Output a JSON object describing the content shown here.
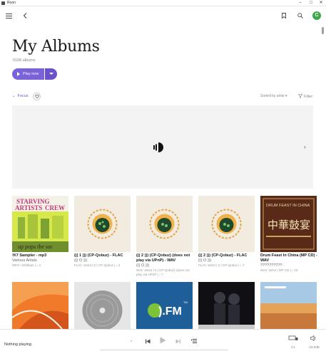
{
  "window": {
    "app_name": "Roon",
    "minimize": "–",
    "maximize": "□",
    "close": "✕"
  },
  "header": {
    "title": "My Albums",
    "count": "5108 albums",
    "avatar_letter": "C"
  },
  "actions": {
    "play_now": "Play now",
    "focus": "Focus",
    "sort": "Sorted by artist",
    "filter": "Filter"
  },
  "albums": [
    {
      "title": "!K7 Sampler - mp3",
      "artist": "Various Artists",
      "format": "MP3 • 320kbps | ♪ 4"
    },
    {
      "title": "((( 1 ))) (CP-Qobuz) - FLAC",
      "artist": "((( O )))",
      "format": "FLAC 16/44 | 2 | CP-Qobuz | ♪ 4"
    },
    {
      "title": "((( 2 ))) (CP-Qobuz) (does not play via UPnP) - WAV",
      "artist": "((( O )))",
      "format": "WAV 16/44 | 2 | CP-Qobuz) (does not play via UPnP | ♪ 7"
    },
    {
      "title": "((( 2 ))) (CP-Qobuz) - FLAC",
      "artist": "((( O )))",
      "format": "FLAC 16/44 | 2 | CP-Qobuz | ♪ 7"
    },
    {
      "title": "Drum Feast In China (MP CD) - WAV",
      "artist": "??????????",
      "format": "WAV 16/44 | MP CD | ♪ 16"
    }
  ],
  "album_art_text": {
    "starving_line1": "STARVING",
    "starving_line2": "ARTISTS",
    "starving_line3": "CREW",
    "starving_bottom": "up pops the sac",
    "drum_title": "DRUM FEAST IN CHINA",
    "drum_chars": "中華鼓宴",
    "fm_text": ").FM",
    "tm": "TM"
  },
  "playbar": {
    "status": "Nothing playing",
    "zone_label": "C1",
    "volume_label": "-19.0dB"
  },
  "colors": {
    "accent": "#7a63d9",
    "avatar": "#3fa94a"
  },
  "icons": [
    "hamburger-icon",
    "back-icon",
    "bookmark-icon",
    "search-icon",
    "heart-icon",
    "filter-icon",
    "roon-logo-icon",
    "prev-icon",
    "play-icon",
    "next-icon",
    "queue-icon",
    "zone-icon",
    "volume-icon"
  ]
}
